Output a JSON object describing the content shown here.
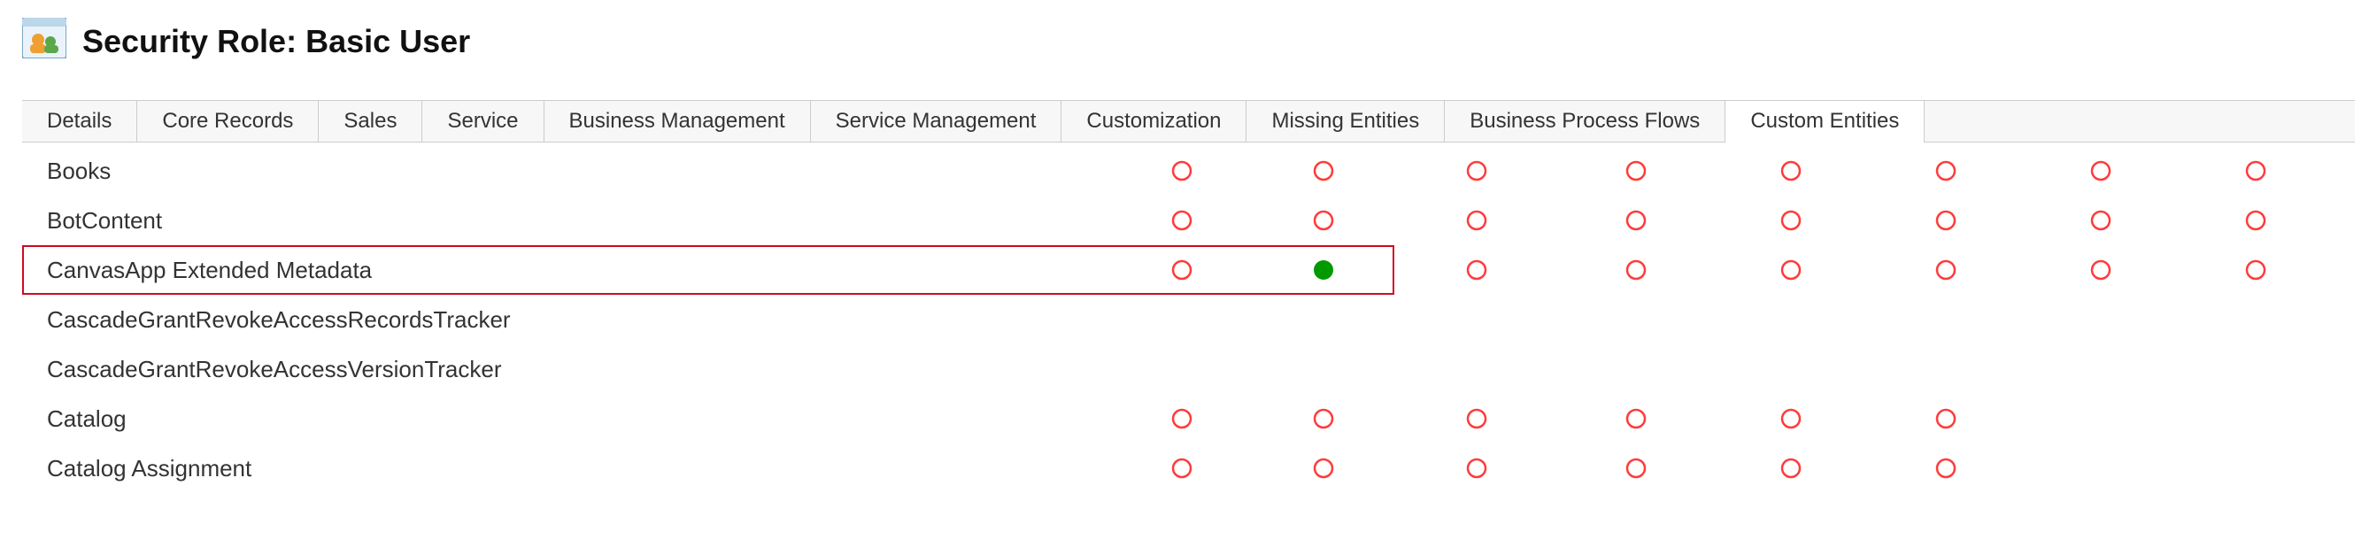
{
  "header": {
    "title": "Security Role: Basic User",
    "icon": "security-role-icon"
  },
  "tabs": [
    {
      "label": "Details",
      "active": false
    },
    {
      "label": "Core Records",
      "active": false
    },
    {
      "label": "Sales",
      "active": false
    },
    {
      "label": "Service",
      "active": false
    },
    {
      "label": "Business Management",
      "active": false
    },
    {
      "label": "Service Management",
      "active": false
    },
    {
      "label": "Customization",
      "active": false
    },
    {
      "label": "Missing Entities",
      "active": false
    },
    {
      "label": "Business Process Flows",
      "active": false
    },
    {
      "label": "Custom Entities",
      "active": true
    }
  ],
  "privilege_icons": {
    "none": "circle-empty-red",
    "full": "circle-full-green",
    "blank": ""
  },
  "colors": {
    "empty_stroke": "#ff3b3b",
    "full_fill": "#009a00",
    "highlight_border": "#d10a24"
  },
  "entities": [
    {
      "name": "Books",
      "highlight": false,
      "privs": [
        "none",
        "none",
        "none",
        "none",
        "none",
        "none",
        "none",
        "none"
      ]
    },
    {
      "name": "BotContent",
      "highlight": false,
      "privs": [
        "none",
        "none",
        "none",
        "none",
        "none",
        "none",
        "none",
        "none"
      ]
    },
    {
      "name": "CanvasApp Extended Metadata",
      "highlight": true,
      "privs": [
        "none",
        "full",
        "none",
        "none",
        "none",
        "none",
        "none",
        "none"
      ]
    },
    {
      "name": "CascadeGrantRevokeAccessRecordsTracker",
      "highlight": false,
      "privs": [
        "blank",
        "blank",
        "blank",
        "blank",
        "blank",
        "blank",
        "blank",
        "blank"
      ]
    },
    {
      "name": "CascadeGrantRevokeAccessVersionTracker",
      "highlight": false,
      "privs": [
        "blank",
        "blank",
        "blank",
        "blank",
        "blank",
        "blank",
        "blank",
        "blank"
      ]
    },
    {
      "name": "Catalog",
      "highlight": false,
      "privs": [
        "none",
        "none",
        "none",
        "none",
        "none",
        "none",
        "blank",
        "blank"
      ]
    },
    {
      "name": "Catalog Assignment",
      "highlight": false,
      "privs": [
        "none",
        "none",
        "none",
        "none",
        "none",
        "none",
        "blank",
        "blank"
      ]
    }
  ]
}
